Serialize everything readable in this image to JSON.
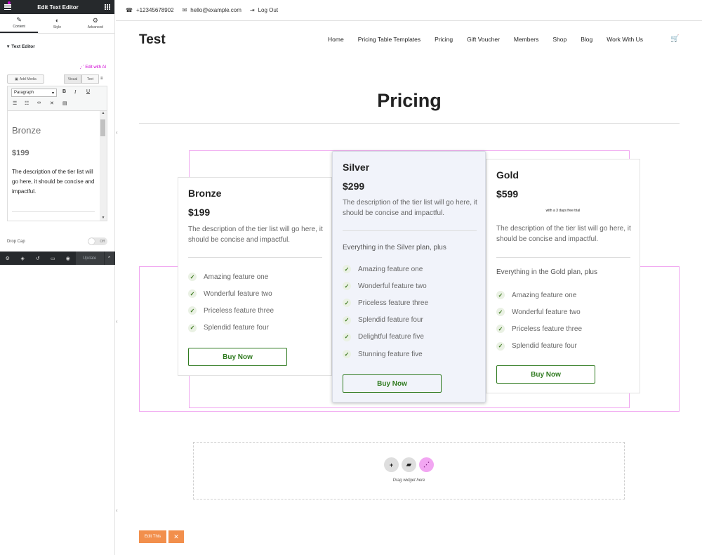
{
  "panel": {
    "title": "Edit Text Editor",
    "tabs": [
      {
        "label": "Content",
        "icon": "pencil-icon",
        "glyph": "✎"
      },
      {
        "label": "Style",
        "icon": "half-circle-icon",
        "glyph": "◐"
      },
      {
        "label": "Advanced",
        "icon": "gear-icon",
        "glyph": "⚙"
      }
    ],
    "section_title": "Text Editor",
    "ai_link": "Edit with AI",
    "add_media": "Add Media",
    "visual_tab": "Visual",
    "text_tab": "Text",
    "paragraph": "Paragraph",
    "editor": {
      "heading": "Bronze",
      "price": "$199",
      "paragraph": "The description of the tier list will go here, it should be concise and impactful."
    },
    "drop_cap_label": "Drop Cap",
    "drop_cap_state": "Off",
    "update_label": "Update"
  },
  "topbar": {
    "phone": "+12345678902",
    "email": "hello@example.com",
    "logout": "Log Out"
  },
  "site": {
    "logo": "Test",
    "nav": [
      "Home",
      "Pricing Table Templates",
      "Pricing",
      "Gift Voucher",
      "Members",
      "Shop",
      "Blog",
      "Work With Us"
    ],
    "page_title": "Pricing"
  },
  "plans": [
    {
      "name": "Bronze",
      "price": "$199",
      "desc": "The description of the tier list will go here, it should be concise and impactful.",
      "features": [
        "Amazing feature one",
        "Wonderful feature two",
        "Priceless feature three",
        "Splendid feature four"
      ],
      "button": "Buy Now"
    },
    {
      "name": "Silver",
      "price": "$299",
      "desc": "The description of the tier list will go here, it should be concise and impactful.",
      "intro": "Everything in the Silver plan, plus",
      "features": [
        "Amazing feature one",
        "Wonderful feature two",
        "Priceless feature three",
        "Splendid feature four",
        "Delightful feature five",
        "Stunning feature five"
      ],
      "button": "Buy Now"
    },
    {
      "name": "Gold",
      "price": "$599",
      "note": "with a 3 days free trial",
      "desc": "The description of the tier list will go here, it should be concise and impactful.",
      "intro": "Everything in the Gold plan, plus",
      "features": [
        "Amazing feature one",
        "Wonderful feature two",
        "Priceless feature three",
        "Splendid feature four"
      ],
      "button": "Buy Now"
    }
  ],
  "dropzone": {
    "text": "Drag widget here"
  },
  "edit_this": "Edit This",
  "colors": {
    "accent_green": "#2f7a1f",
    "editor_pink": "#d004d4",
    "edit_orange": "#f28f4c"
  }
}
